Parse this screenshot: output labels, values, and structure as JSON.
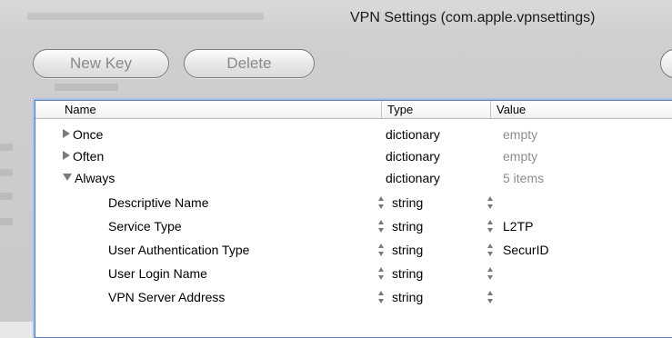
{
  "window": {
    "title": "VPN Settings (com.apple.vpnsettings)"
  },
  "toolbar": {
    "new_key_label": "New Key",
    "delete_label": "Delete"
  },
  "table": {
    "headers": {
      "name": "Name",
      "type": "Type",
      "value": "Value"
    },
    "rows": [
      {
        "name": "Once",
        "type": "dictionary",
        "value": "empty",
        "disclosure": "collapsed"
      },
      {
        "name": "Often",
        "type": "dictionary",
        "value": "empty",
        "disclosure": "collapsed"
      },
      {
        "name": "Always",
        "type": "dictionary",
        "value": "5 items",
        "disclosure": "expanded"
      },
      {
        "name": "Descriptive Name",
        "type": "string",
        "value": ""
      },
      {
        "name": "Service Type",
        "type": "string",
        "value": "L2TP"
      },
      {
        "name": "User Authentication Type",
        "type": "string",
        "value": "SecurID"
      },
      {
        "name": "User Login Name",
        "type": "string",
        "value": ""
      },
      {
        "name": "VPN Server Address",
        "type": "string",
        "value": ""
      }
    ]
  },
  "icons": {
    "disclosure_collapsed": "triangle-right-icon",
    "disclosure_expanded": "triangle-down-icon",
    "stepper": "up-down-stepper-icon"
  },
  "colors": {
    "focus_ring": "#a9c0e6",
    "muted_value": "#8c8c8c",
    "window_bg": "#cfcfcf"
  }
}
